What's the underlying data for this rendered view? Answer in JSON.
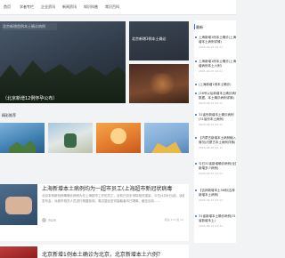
{
  "nav": {
    "items": [
      "首页",
      "学者专栏",
      "企业资讯",
      "新闻资讯",
      "知识科普",
      "常识百科"
    ]
  },
  "hero": {
    "main_tag": "北京新增首例本土确诊病例",
    "main_caption": "（北京新增12例怀孕公布）",
    "side1_caption": "北京新增3例本土确诊",
    "side2_caption": ""
  },
  "section": {
    "title": "精彩推荐",
    "thumbs": [
      "",
      "",
      "",
      ""
    ]
  },
  "article1": {
    "title": "上海新增本土病例均为一超市员工(上海超市新冠状病毒",
    "excerpt_l1": "北京本例新冠病毒确诊病例为在上海超市工作的员工，目前已初步排除相关感染，今日(4月8日)起，该超市暂停营业，",
    "excerpt_l2": "发布会，对超市相关人员进行核酸检测，周边居民密切接触者均已隔离，截至目前……",
    "author": "阅读量",
    "stats": "阅读 271    赞 12"
  },
  "article2": {
    "title": "北京新增1例本土确诊为北京，北京新增本土六例？"
  },
  "sidebar": {
    "title": "最新",
    "items": [
      {
        "t1": "上海新增1例本土确诊(上海新",
        "t2": "增本土病例详情)",
        "date": "2025-04-07 22:11"
      },
      {
        "t1": "上海新增1例本土确诊(上海新",
        "t2": "增病例本土六例)",
        "date": "2025-04-07 22:11"
      },
      {
        "t1": "(上海新增1例本土确诊)",
        "t2": "",
        "date": ""
      },
      {
        "t1": "(26号以后新增本土确诊病例",
        "t2": "数据，本土确诊病例详情)",
        "date": "2025-04-07 22:11"
      },
      {
        "t1": "31省份新增本土确诊病例",
        "t2": "(31省份本土病例)",
        "date": "2025-04-07 22:11"
      },
      {
        "t1": "【内蒙古新增本土病例输入",
        "t2": "情况(内蒙古本土病例详情)",
        "date": "2025-04-07 22:11"
      },
      {
        "t1": "今日31省新增确诊病例(全国",
        "t2": "新增多少病例)",
        "date": "2025-04-07 22:11"
      },
      {
        "t1": "【吉林新增本土56例(吉林",
        "t2": "新增本土病例)",
        "date": "2025-04-07 22:11"
      },
      {
        "t1": "31省新增本土确诊病例(31",
        "t2": "省新增本土)",
        "date": "2025-04-07 22:11"
      }
    ]
  }
}
